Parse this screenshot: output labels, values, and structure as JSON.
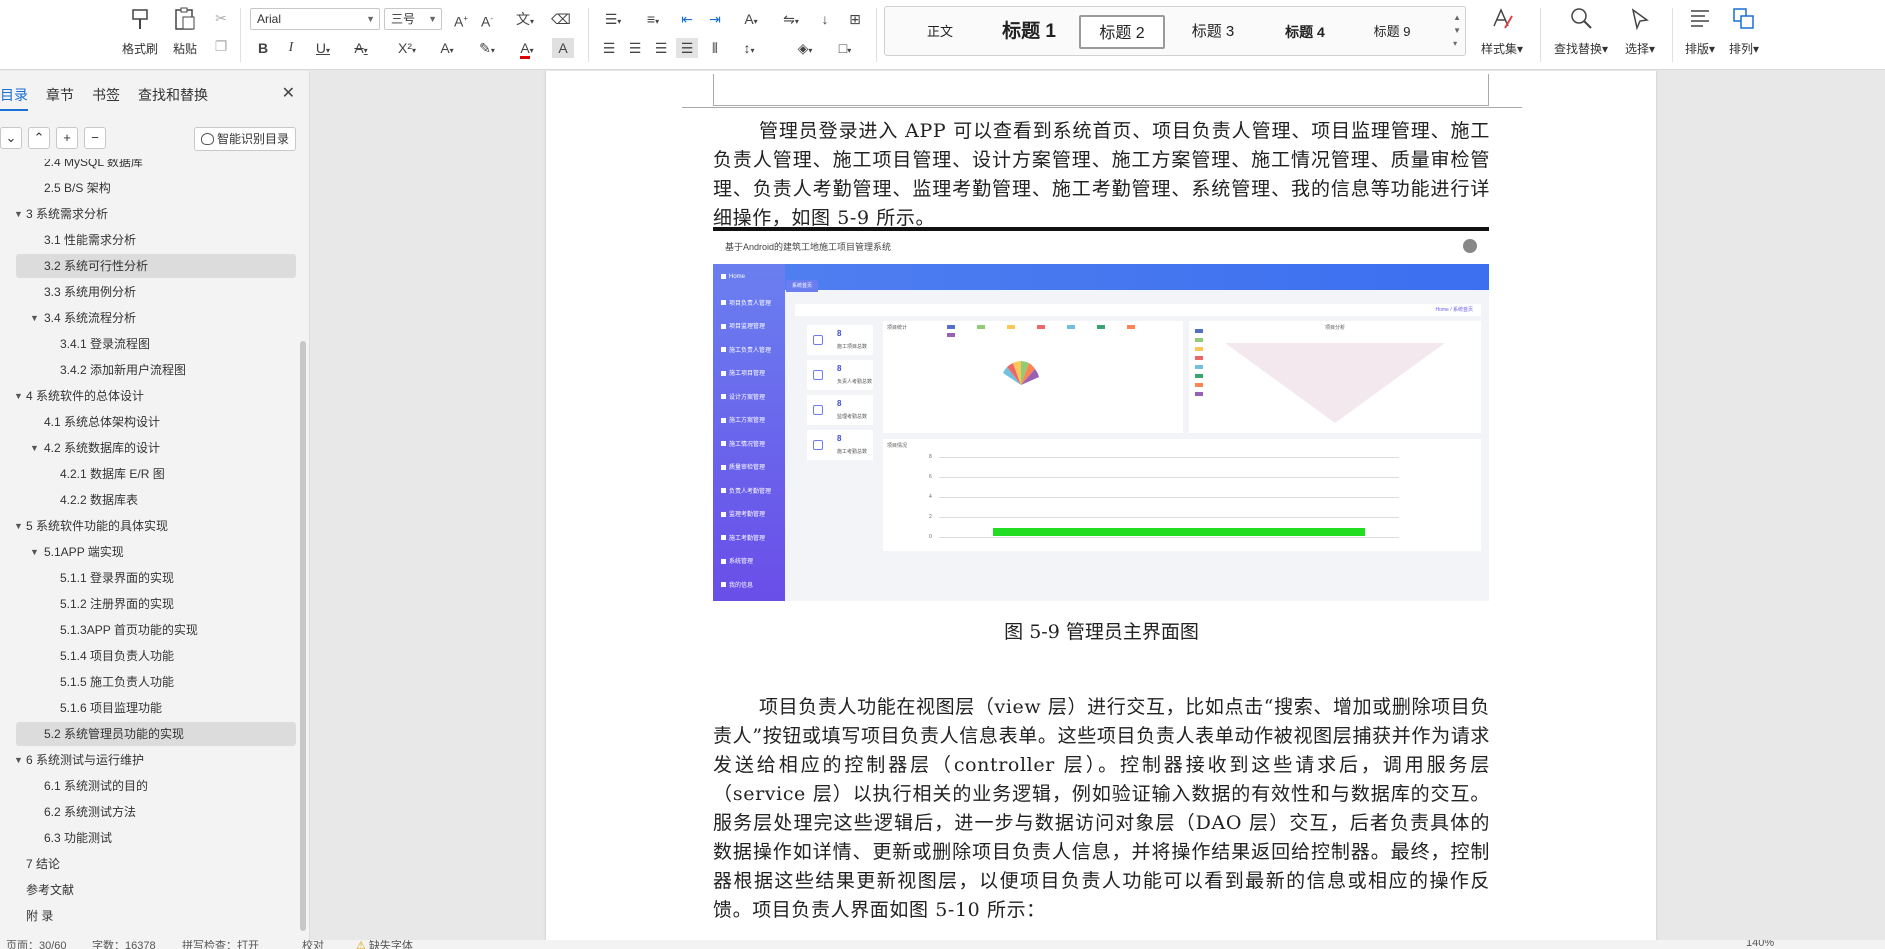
{
  "ribbon": {
    "format_painter": "格式刷",
    "paste": "粘贴",
    "font_name": "Arial",
    "font_size": "三号",
    "style_set": "样式集",
    "find_replace": "查找替换",
    "select": "选择",
    "typesetting": "排版",
    "arrange": "排列",
    "styles": [
      {
        "label": "正文",
        "selected": false
      },
      {
        "label": "标题 1",
        "selected": false
      },
      {
        "label": "标题 2",
        "selected": true
      },
      {
        "label": "标题 3",
        "selected": false
      },
      {
        "label": "标题 4",
        "selected": false
      },
      {
        "label": "标题 9",
        "selected": false
      }
    ]
  },
  "nav": {
    "tabs": [
      "目录",
      "章节",
      "书签",
      "查找和替换"
    ],
    "active_tab": "目录",
    "smart_toc": "智能识别目录",
    "items": [
      {
        "label": "2.4 MySQL 数据库",
        "level": 2,
        "highlight": false,
        "expander": false
      },
      {
        "label": "2.5 B/S 架构",
        "level": 2,
        "highlight": false,
        "expander": false
      },
      {
        "label": "3 系统需求分析",
        "level": 1,
        "highlight": false,
        "expander": true
      },
      {
        "label": "3.1 性能需求分析",
        "level": 2,
        "highlight": false,
        "expander": false
      },
      {
        "label": "3.2 系统可行性分析",
        "level": 2,
        "highlight": true,
        "expander": false
      },
      {
        "label": "3.3 系统用例分析",
        "level": 2,
        "highlight": false,
        "expander": false
      },
      {
        "label": "3.4 系统流程分析",
        "level": 2,
        "highlight": false,
        "expander": true
      },
      {
        "label": "3.4.1  登录流程图",
        "level": 3,
        "highlight": false,
        "expander": false
      },
      {
        "label": "3.4.2  添加新用户流程图",
        "level": 3,
        "highlight": false,
        "expander": false
      },
      {
        "label": "4  系统软件的总体设计",
        "level": 1,
        "highlight": false,
        "expander": true
      },
      {
        "label": "4.1 系统总体架构设计",
        "level": 2,
        "highlight": false,
        "expander": false
      },
      {
        "label": "4.2 系统数据库的设计",
        "level": 2,
        "highlight": false,
        "expander": true
      },
      {
        "label": "4.2.1 数据库 E/R 图",
        "level": 3,
        "highlight": false,
        "expander": false
      },
      {
        "label": "4.2.2 数据库表",
        "level": 3,
        "highlight": false,
        "expander": false
      },
      {
        "label": "5  系统软件功能的具体实现",
        "level": 1,
        "highlight": false,
        "expander": true
      },
      {
        "label": "5.1APP 端实现",
        "level": 2,
        "highlight": false,
        "expander": true
      },
      {
        "label": "5.1.1 登录界面的实现",
        "level": 3,
        "highlight": false,
        "expander": false
      },
      {
        "label": "5.1.2 注册界面的实现",
        "level": 3,
        "highlight": false,
        "expander": false
      },
      {
        "label": "5.1.3APP 首页功能的实现",
        "level": 3,
        "highlight": false,
        "expander": false
      },
      {
        "label": "5.1.4 项目负责人功能",
        "level": 3,
        "highlight": false,
        "expander": false
      },
      {
        "label": "5.1.5 施工负责人功能",
        "level": 3,
        "highlight": false,
        "expander": false
      },
      {
        "label": "5.1.6 项目监理功能",
        "level": 3,
        "highlight": false,
        "expander": false
      },
      {
        "label": "5.2 系统管理员功能的实现",
        "level": 2,
        "highlight": true,
        "expander": false
      },
      {
        "label": "6 系统测试与运行维护",
        "level": 1,
        "highlight": false,
        "expander": true
      },
      {
        "label": "6.1 系统测试的目的",
        "level": 2,
        "highlight": false,
        "expander": false
      },
      {
        "label": "6.2 系统测试方法",
        "level": 2,
        "highlight": false,
        "expander": false
      },
      {
        "label": "6.3  功能测试",
        "level": 2,
        "highlight": false,
        "expander": false
      },
      {
        "label": "7 结论",
        "level": 1,
        "highlight": false,
        "expander": false
      },
      {
        "label": "参考文献",
        "level": 1,
        "highlight": false,
        "expander": false
      },
      {
        "label": "附  录",
        "level": 1,
        "highlight": false,
        "expander": false
      }
    ]
  },
  "doc": {
    "para1": "管理员登录进入 APP 可以查看到系统首页、项目负责人管理、项目监理管理、施工负责人管理、施工项目管理、设计方案管理、施工方案管理、施工情况管理、质量审检管理、负责人考勤管理、监理考勤管理、施工考勤管理、系统管理、我的信息等功能进行详细操作，如图 5-9 所示。",
    "caption": "图 5-9 管理员主界面图",
    "para2": "项目负责人功能在视图层（view 层）进行交互，比如点击“搜索、增加或删除项目负责人”按钮或填写项目负责人信息表单。这些项目负责人表单动作被视图层捕获并作为请求发送给相应的控制器层（controller 层）。控制器接收到这些请求后，调用服务层（service 层）以执行相关的业务逻辑，例如验证输入数据的有效性和与数据库的交互。服务层处理完这些逻辑后，进一步与数据访问对象层（DAO 层）交互，后者负责具体的数据操作如详情、更新或删除项目负责人信息，并将操作结果返回给控制器。最终，控制器根据这些结果更新视图层，以便项目负责人功能可以看到最新的信息或相应的操作反馈。项目负责人界面如图 5-10 所示："
  },
  "figure": {
    "title": "基于Android的建筑工地施工项目管理系统",
    "tab": "系统首页",
    "breadcrumb": "Home / 系统首页",
    "sidebar": [
      "Home",
      "项目负责人管理",
      "项目监理管理",
      "施工负责人管理",
      "施工项目管理",
      "设计方案管理",
      "施工方案管理",
      "施工情况管理",
      "质量审检管理",
      "负责人考勤管理",
      "监理考勤管理",
      "施工考勤管理",
      "系统管理",
      "我的信息"
    ],
    "stats": [
      {
        "value": "8",
        "label": "施工项目总数"
      },
      {
        "value": "8",
        "label": "负责人考勤总数"
      },
      {
        "value": "8",
        "label": "监理考勤总数"
      },
      {
        "value": "8",
        "label": "施工考勤总数"
      }
    ],
    "card1_title": "项目统计",
    "card2_title": "项目分析",
    "card3_title": "项目情况",
    "legend_colors": [
      "#5470c6",
      "#91cc75",
      "#fac858",
      "#ee6666",
      "#73c0de",
      "#3ba272",
      "#fc8452",
      "#9a60b4"
    ],
    "funnel_colors": [
      "#5470c6",
      "#91cc75",
      "#fac858",
      "#ee6666",
      "#73c0de",
      "#3ba272",
      "#fc8452",
      "#9a60b4"
    ],
    "bar_color": "#22dd22",
    "yticks": [
      "8",
      "6",
      "4",
      "2",
      "0"
    ]
  },
  "status": {
    "page": "页面：30/60",
    "words": "字数：16378",
    "spell": "拼写检查：打开",
    "proof": "校对",
    "font_missing": "缺失字体",
    "zoom": "140%"
  }
}
